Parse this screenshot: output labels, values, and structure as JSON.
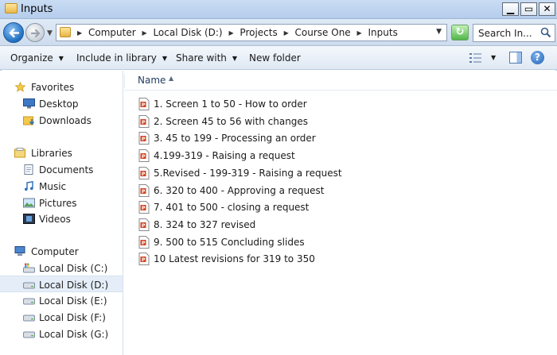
{
  "window": {
    "title": "Inputs",
    "min_glyph": "▁",
    "max_glyph": "▭",
    "close_glyph": "✕"
  },
  "address": {
    "crumbs": [
      "Computer",
      "Local Disk (D:)",
      "Projects",
      "Course One",
      "Inputs"
    ],
    "separator": "▶"
  },
  "search": {
    "placeholder": "Search In..."
  },
  "toolbar": {
    "organize": "Organize",
    "include": "Include in library",
    "share": "Share with",
    "new_folder": "New folder",
    "dropdown_glyph": "▼"
  },
  "nav": {
    "favorites": "Favorites",
    "desktop": "Desktop",
    "downloads": "Downloads",
    "libraries": "Libraries",
    "documents": "Documents",
    "music": "Music",
    "pictures": "Pictures",
    "videos": "Videos",
    "computer": "Computer",
    "disk_c": "Local Disk (C:)",
    "disk_d": "Local Disk (D:)",
    "disk_e": "Local Disk (E:)",
    "disk_f": "Local Disk (F:)",
    "disk_g": "Local Disk (G:)"
  },
  "list": {
    "column_name": "Name",
    "sort_glyph": "▲",
    "files": [
      "1. Screen 1 to 50 - How to order",
      "2. Screen 45 to 56 with changes",
      "3. 45 to 199 - Processing an order",
      "4.199-319 - Raising a request",
      "5.Revised - 199-319 - Raising a request",
      "6. 320 to 400 - Approving a request",
      "7. 401 to 500 - closing a request",
      "8. 324 to 327 revised",
      "9. 500 to 515 Concluding slides",
      "10 Latest revisions for 319 to 350"
    ]
  },
  "colors": {
    "titlebar": "#b5cdec",
    "selected_row": "#e5eef8",
    "ppt_orange": "#d24726"
  }
}
